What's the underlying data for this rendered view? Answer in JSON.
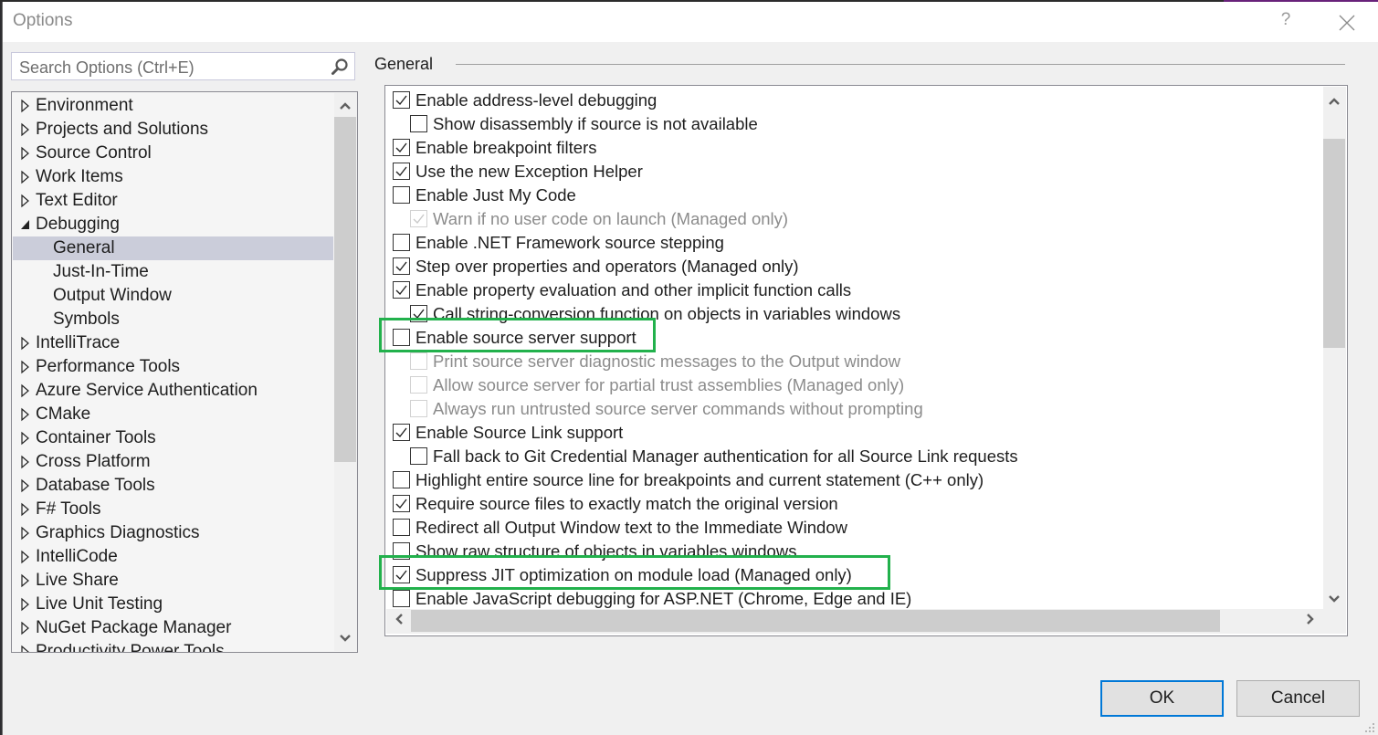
{
  "window": {
    "title": "Options",
    "help_icon": "question-mark-icon",
    "close_icon": "close-icon"
  },
  "search": {
    "placeholder": "Search Options (Ctrl+E)",
    "value": "",
    "icon": "search-icon"
  },
  "tree": {
    "items": [
      {
        "label": "Environment",
        "expanded": false,
        "level": 0
      },
      {
        "label": "Projects and Solutions",
        "expanded": false,
        "level": 0
      },
      {
        "label": "Source Control",
        "expanded": false,
        "level": 0
      },
      {
        "label": "Work Items",
        "expanded": false,
        "level": 0
      },
      {
        "label": "Text Editor",
        "expanded": false,
        "level": 0
      },
      {
        "label": "Debugging",
        "expanded": true,
        "level": 0
      },
      {
        "label": "General",
        "level": 1,
        "selected": true
      },
      {
        "label": "Just-In-Time",
        "level": 1
      },
      {
        "label": "Output Window",
        "level": 1
      },
      {
        "label": "Symbols",
        "level": 1
      },
      {
        "label": "IntelliTrace",
        "expanded": false,
        "level": 0
      },
      {
        "label": "Performance Tools",
        "expanded": false,
        "level": 0
      },
      {
        "label": "Azure Service Authentication",
        "expanded": false,
        "level": 0
      },
      {
        "label": "CMake",
        "expanded": false,
        "level": 0
      },
      {
        "label": "Container Tools",
        "expanded": false,
        "level": 0
      },
      {
        "label": "Cross Platform",
        "expanded": false,
        "level": 0
      },
      {
        "label": "Database Tools",
        "expanded": false,
        "level": 0
      },
      {
        "label": "F# Tools",
        "expanded": false,
        "level": 0
      },
      {
        "label": "Graphics Diagnostics",
        "expanded": false,
        "level": 0
      },
      {
        "label": "IntelliCode",
        "expanded": false,
        "level": 0
      },
      {
        "label": "Live Share",
        "expanded": false,
        "level": 0
      },
      {
        "label": "Live Unit Testing",
        "expanded": false,
        "level": 0
      },
      {
        "label": "NuGet Package Manager",
        "expanded": false,
        "level": 0
      },
      {
        "label": "Productivity Power Tools",
        "expanded": false,
        "level": 0
      }
    ]
  },
  "section": {
    "title": "General"
  },
  "options": [
    {
      "label": "Enable address-level debugging",
      "checked": true,
      "indent": 0,
      "enabled": true
    },
    {
      "label": "Show disassembly if source is not available",
      "checked": false,
      "indent": 1,
      "enabled": true
    },
    {
      "label": "Enable breakpoint filters",
      "checked": true,
      "indent": 0,
      "enabled": true
    },
    {
      "label": "Use the new Exception Helper",
      "checked": true,
      "indent": 0,
      "enabled": true
    },
    {
      "label": "Enable Just My Code",
      "checked": false,
      "indent": 0,
      "enabled": true
    },
    {
      "label": "Warn if no user code on launch (Managed only)",
      "checked": true,
      "indent": 1,
      "enabled": false
    },
    {
      "label": "Enable .NET Framework source stepping",
      "checked": false,
      "indent": 0,
      "enabled": true
    },
    {
      "label": "Step over properties and operators (Managed only)",
      "checked": true,
      "indent": 0,
      "enabled": true
    },
    {
      "label": "Enable property evaluation and other implicit function calls",
      "checked": true,
      "indent": 0,
      "enabled": true
    },
    {
      "label": "Call string-conversion function on objects in variables windows",
      "checked": true,
      "indent": 1,
      "enabled": true
    },
    {
      "label": "Enable source server support",
      "checked": false,
      "indent": 0,
      "enabled": true,
      "highlighted": true
    },
    {
      "label": "Print source server diagnostic messages to the Output window",
      "checked": false,
      "indent": 1,
      "enabled": false
    },
    {
      "label": "Allow source server for partial trust assemblies (Managed only)",
      "checked": false,
      "indent": 1,
      "enabled": false
    },
    {
      "label": "Always run untrusted source server commands without prompting",
      "checked": false,
      "indent": 1,
      "enabled": false
    },
    {
      "label": "Enable Source Link support",
      "checked": true,
      "indent": 0,
      "enabled": true
    },
    {
      "label": "Fall back to Git Credential Manager authentication for all Source Link requests",
      "checked": false,
      "indent": 1,
      "enabled": true
    },
    {
      "label": "Highlight entire source line for breakpoints and current statement (C++ only)",
      "checked": false,
      "indent": 0,
      "enabled": true
    },
    {
      "label": "Require source files to exactly match the original version",
      "checked": true,
      "indent": 0,
      "enabled": true
    },
    {
      "label": "Redirect all Output Window text to the Immediate Window",
      "checked": false,
      "indent": 0,
      "enabled": true
    },
    {
      "label": "Show raw structure of objects in variables windows",
      "checked": false,
      "indent": 0,
      "enabled": true
    },
    {
      "label": "Suppress JIT optimization on module load (Managed only)",
      "checked": true,
      "indent": 0,
      "enabled": true,
      "highlighted": true
    },
    {
      "label": "Enable JavaScript debugging for ASP.NET (Chrome, Edge and IE)",
      "checked": false,
      "indent": 0,
      "enabled": true
    }
  ],
  "highlight_color": "#22b14c",
  "buttons": {
    "ok": "OK",
    "cancel": "Cancel"
  },
  "colors": {
    "accent": "#0078d7",
    "selection": "#cbcdda"
  }
}
